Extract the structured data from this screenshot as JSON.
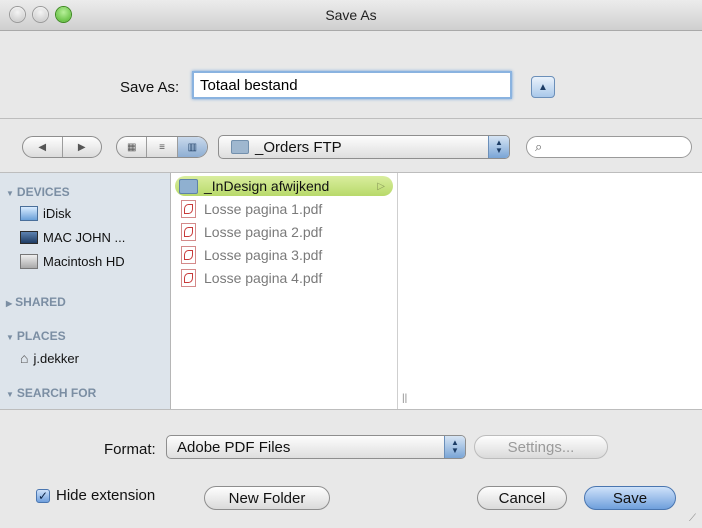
{
  "window": {
    "title": "Save As"
  },
  "save_as": {
    "label": "Save As:",
    "value": "Totaal bestand"
  },
  "toolbar": {
    "back_glyph": "◀",
    "forward_glyph": "▶",
    "view_icon_glyph": "▦",
    "view_list_glyph": "≡",
    "view_column_glyph": "▥",
    "location": "_Orders FTP",
    "search_glyph": "⌕"
  },
  "sidebar": {
    "devices_header": "DEVICES",
    "devices": [
      "iDisk",
      "MAC JOHN ...",
      "Macintosh HD"
    ],
    "shared_header": "SHARED",
    "places_header": "PLACES",
    "places": [
      "j.dekker"
    ],
    "search_header": "SEARCH FOR"
  },
  "files": [
    {
      "name": "_InDesign afwijkend",
      "type": "folder",
      "selected": true
    },
    {
      "name": "Losse pagina 1.pdf",
      "type": "pdf"
    },
    {
      "name": "Losse pagina 2.pdf",
      "type": "pdf"
    },
    {
      "name": "Losse pagina 3.pdf",
      "type": "pdf"
    },
    {
      "name": "Losse pagina 4.pdf",
      "type": "pdf"
    }
  ],
  "format": {
    "label": "Format:",
    "value": "Adobe PDF Files",
    "settings_label": "Settings..."
  },
  "footer": {
    "hide_extension_label": "Hide extension",
    "hide_extension_checked": true,
    "new_folder_label": "New Folder",
    "cancel_label": "Cancel",
    "save_label": "Save"
  },
  "colors": {
    "selection": "#c4e07f",
    "default_button": "#6f9fdc"
  }
}
